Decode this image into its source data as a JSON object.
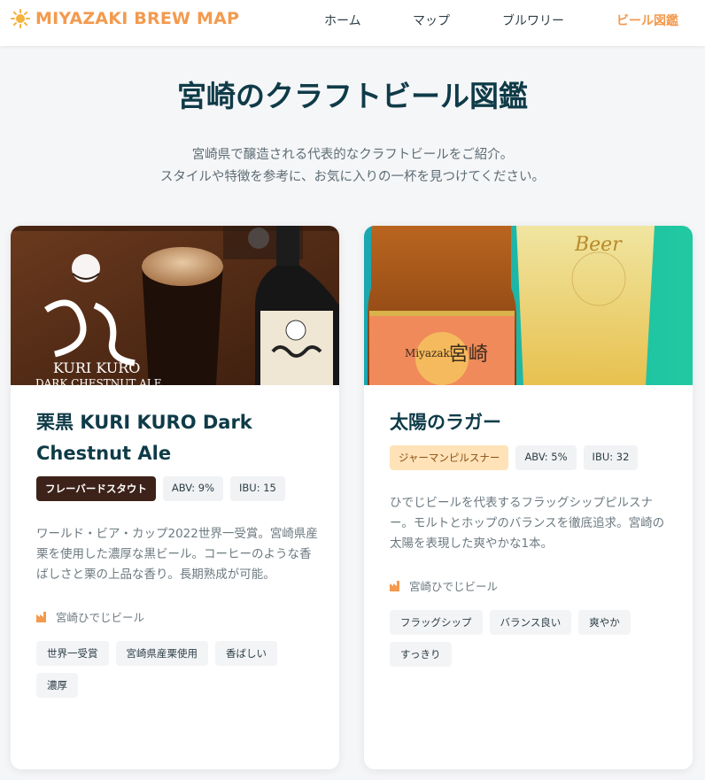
{
  "header": {
    "brand": "MIYAZAKI BREW MAP",
    "logo_icon": "sun-icon",
    "accent": "#f39a4e",
    "nav": [
      {
        "label": "ホーム",
        "active": false
      },
      {
        "label": "マップ",
        "active": false
      },
      {
        "label": "ブルワリー",
        "active": false
      },
      {
        "label": "ビール図鑑",
        "active": true
      }
    ]
  },
  "hero": {
    "title": "宮崎のクラフトビール図鑑",
    "subtitle_line1": "宮崎県で醸造される代表的なクラフトビールをご紹介。",
    "subtitle_line2": "スタイルや特徴を参考に、お気に入りの一杯を見つけてください。"
  },
  "beers": [
    {
      "name": "栗黒 KURI KURO Dark Chestnut Ale",
      "style": "フレーバードスタウト",
      "abv": "ABV: 9%",
      "ibu": "IBU: 15",
      "description": "ワールド・ビア・カップ2022世界一受賞。宮崎県産栗を使用した濃厚な黒ビール。コーヒーのような香ばしさと栗の上品な香り。長期熟成が可能。",
      "brewery": "宮崎ひでじビール",
      "tags": [
        "世界一受賞",
        "宮崎県産栗使用",
        "香ばしい",
        "濃厚"
      ],
      "image_label_1": "KURI KURO",
      "image_label_2": "DARK CHESTNUT ALE"
    },
    {
      "name": "太陽のラガー",
      "style": "ジャーマンピルスナー",
      "abv": "ABV: 5%",
      "ibu": "IBU: 32",
      "description": "ひでじビールを代表するフラッグシップピルスナー。モルトとホップのバランスを徹底追求。宮崎の太陽を表現した爽やかな1本。",
      "brewery": "宮崎ひでじビール",
      "tags": [
        "フラッグシップ",
        "バランス良い",
        "爽やか",
        "すっきり"
      ],
      "image_label_1": "Miyazaki",
      "image_label_2": "宮崎",
      "image_label_3": "Beer"
    }
  ]
}
